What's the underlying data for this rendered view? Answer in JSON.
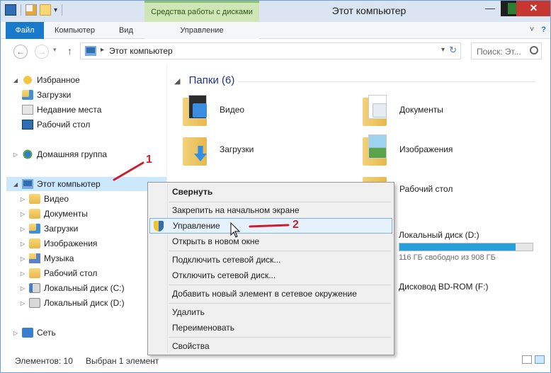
{
  "titlebar": {
    "title": "Этот компьютер",
    "context_tab": "Средства работы с дисками",
    "minimize": "—",
    "maximize": "",
    "close": "✕"
  },
  "ribbon": {
    "tabs": {
      "file": "Файл",
      "computer": "Компьютер",
      "view": "Вид",
      "manage": "Управление"
    },
    "right_chevron": "˅",
    "help": "?"
  },
  "address": {
    "back": "←",
    "forward": "→",
    "recent": "▾",
    "up": "↑",
    "chevron": "▸",
    "path": "Этот компьютер",
    "dropdown": "▾",
    "refresh": "↻",
    "search_placeholder": "Поиск: Эт..."
  },
  "navpane": {
    "favorites": {
      "label": "Избранное",
      "twisty": "◢"
    },
    "downloads": "Загрузки",
    "recent_places": "Недавние места",
    "desktop": "Рабочий стол",
    "homegroup": {
      "label": "Домашняя группа",
      "twisty": "▷"
    },
    "this_pc": {
      "label": "Этот компьютер",
      "twisty": "◢"
    },
    "pc_children": [
      {
        "label": "Видео",
        "twisty": "▷",
        "icon": "video-folder-icon"
      },
      {
        "label": "Документы",
        "twisty": "▷",
        "icon": "documents-folder-icon"
      },
      {
        "label": "Загрузки",
        "twisty": "▷",
        "icon": "downloads-folder-icon"
      },
      {
        "label": "Изображения",
        "twisty": "▷",
        "icon": "pictures-folder-icon"
      },
      {
        "label": "Музыка",
        "twisty": "▷",
        "icon": "music-folder-icon"
      },
      {
        "label": "Рабочий стол",
        "twisty": "▷",
        "icon": "desktop-folder-icon"
      },
      {
        "label": "Локальный диск (C:)",
        "twisty": "▷",
        "icon": "local-disk-c-icon"
      },
      {
        "label": "Локальный диск (D:)",
        "twisty": "▷",
        "icon": "local-disk-d-icon"
      }
    ],
    "network": {
      "label": "Сеть",
      "twisty": "▷"
    }
  },
  "content": {
    "group_chevron": "◢",
    "group_title": "Папки (6)",
    "folders": [
      {
        "label": "Видео",
        "icon": "video-folder-icon"
      },
      {
        "label": "Документы",
        "icon": "documents-folder-icon"
      },
      {
        "label": "Загрузки",
        "icon": "downloads-folder-icon"
      },
      {
        "label": "Изображения",
        "icon": "pictures-folder-icon"
      },
      {
        "label": "Рабочий стол",
        "icon": "desktop-folder-icon"
      }
    ],
    "drive_d": {
      "label": "Локальный диск (D:)",
      "free": "116 ГБ свободно из 908 ГБ",
      "used_fraction": 0.87
    },
    "drive_bd": {
      "label": "Дисковод BD-ROM (F:)"
    }
  },
  "context_menu": {
    "items": [
      {
        "label": "Свернуть",
        "bold": true
      },
      {
        "label": "Закрепить на начальном экране"
      },
      {
        "label": "Управление",
        "highlighted": true
      },
      {
        "label": "Открыть в новом окне"
      },
      {
        "label": "Подключить сетевой диск..."
      },
      {
        "label": "Отключить сетевой диск..."
      },
      {
        "label": "Добавить новый элемент в сетевое окружение"
      },
      {
        "label": "Удалить"
      },
      {
        "label": "Переименовать"
      },
      {
        "label": "Свойства"
      }
    ]
  },
  "annotations": {
    "step1": "1",
    "step2": "2",
    "color": "#cc1f2e"
  },
  "statusbar": {
    "items": "Элементов: 10",
    "selected": "Выбран 1 элемент"
  },
  "colors": {
    "accent": "#1979ca",
    "selection": "#cce8ff",
    "context_tab": "#cfe6b6",
    "close": "#c7372f",
    "drive_fill": "#26a0da"
  }
}
